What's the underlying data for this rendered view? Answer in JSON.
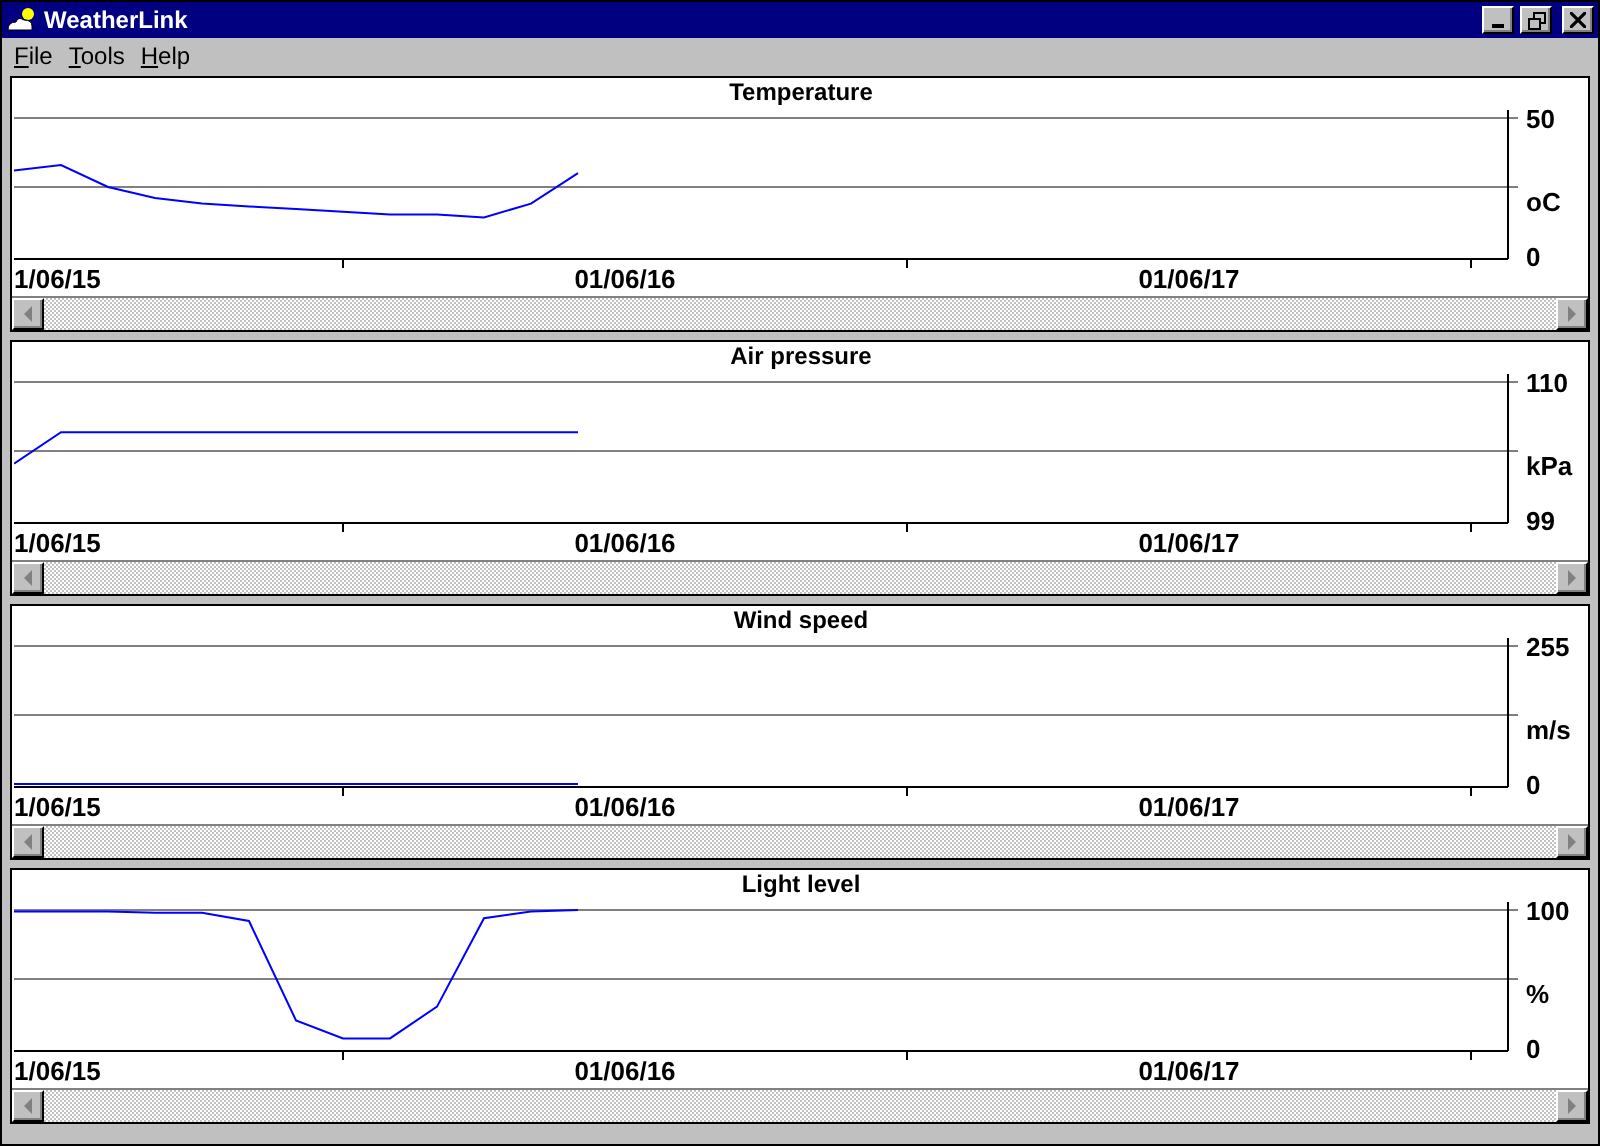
{
  "window": {
    "title": "WeatherLink"
  },
  "menu": [
    {
      "label": "File"
    },
    {
      "label": "Tools"
    },
    {
      "label": "Help"
    }
  ],
  "panels": [
    {
      "chart_data": {
        "type": "line",
        "title": "Temperature",
        "ylabel": "oC",
        "categories": [
          null,
          "1/06/15",
          null,
          null,
          null,
          null,
          null,
          null,
          null,
          null,
          null,
          null,
          null,
          "01/06/16",
          null,
          null,
          null,
          null,
          null,
          null,
          null,
          null,
          null,
          null,
          null,
          "01/06/17",
          null,
          null,
          null,
          null,
          null,
          null
        ],
        "series": [
          {
            "color": "#0000ff",
            "values": [
              31,
              33,
              25,
              21,
              19,
              18,
              17,
              16,
              15,
              15,
              14,
              19,
              30,
              null,
              null,
              null,
              null,
              null,
              null,
              null,
              null,
              null,
              null,
              null,
              null,
              null,
              null,
              null,
              null,
              null,
              null,
              null
            ]
          }
        ],
        "ylim": [
          0,
          50
        ],
        "yticks": [
          0,
          50
        ],
        "ref_lines": [
          {
            "axis": "y",
            "value": 25
          }
        ]
      }
    },
    {
      "chart_data": {
        "type": "line",
        "title": "Air pressure",
        "ylabel": "kPa",
        "categories": [
          null,
          "1/06/15",
          null,
          null,
          null,
          null,
          null,
          null,
          null,
          null,
          null,
          null,
          null,
          "01/06/16",
          null,
          null,
          null,
          null,
          null,
          null,
          null,
          null,
          null,
          null,
          null,
          "01/06/17",
          null,
          null,
          null,
          null,
          null,
          null
        ],
        "series": [
          {
            "color": "#0000ff",
            "values": [
              103.5,
              106,
              106,
              106,
              106,
              106,
              106,
              106,
              106,
              106,
              106,
              106,
              106,
              null,
              null,
              null,
              null,
              null,
              null,
              null,
              null,
              null,
              null,
              null,
              null,
              null,
              null,
              null,
              null,
              null,
              null,
              null
            ]
          }
        ],
        "ylim": [
          99,
          110
        ],
        "yticks": [
          99,
          110
        ],
        "ref_lines": [
          {
            "axis": "y",
            "value": 104.5
          }
        ]
      }
    },
    {
      "chart_data": {
        "type": "line",
        "title": "Wind speed",
        "ylabel": "m/s",
        "categories": [
          null,
          "1/06/15",
          null,
          null,
          null,
          null,
          null,
          null,
          null,
          null,
          null,
          null,
          null,
          "01/06/16",
          null,
          null,
          null,
          null,
          null,
          null,
          null,
          null,
          null,
          null,
          null,
          "01/06/17",
          null,
          null,
          null,
          null,
          null,
          null
        ],
        "series": [
          {
            "color": "#0000ff",
            "values": [
              0,
              0,
              0,
              0,
              0,
              0,
              0,
              0,
              0,
              0,
              0,
              0,
              0,
              null,
              null,
              null,
              null,
              null,
              null,
              null,
              null,
              null,
              null,
              null,
              null,
              null,
              null,
              null,
              null,
              null,
              null,
              null
            ]
          }
        ],
        "ylim": [
          0,
          255
        ],
        "yticks": [
          0,
          255
        ],
        "ref_lines": [
          {
            "axis": "y",
            "value": 127.5
          }
        ]
      }
    },
    {
      "chart_data": {
        "type": "line",
        "title": "Light level",
        "ylabel": "%",
        "categories": [
          null,
          "1/06/15",
          null,
          null,
          null,
          null,
          null,
          null,
          null,
          null,
          null,
          null,
          null,
          "01/06/16",
          null,
          null,
          null,
          null,
          null,
          null,
          null,
          null,
          null,
          null,
          null,
          "01/06/17",
          null,
          null,
          null,
          null,
          null,
          null
        ],
        "series": [
          {
            "color": "#0000ff",
            "values": [
              99,
              99,
              99,
              98,
              98,
              92,
              20,
              7,
              7,
              30,
              94,
              99,
              100,
              null,
              null,
              null,
              null,
              null,
              null,
              null,
              null,
              null,
              null,
              null,
              null,
              null,
              null,
              null,
              null,
              null,
              null,
              null
            ]
          }
        ],
        "ylim": [
          0,
          100
        ],
        "yticks": [
          0,
          100
        ],
        "ref_lines": [
          {
            "axis": "y",
            "value": 50
          }
        ]
      }
    }
  ]
}
